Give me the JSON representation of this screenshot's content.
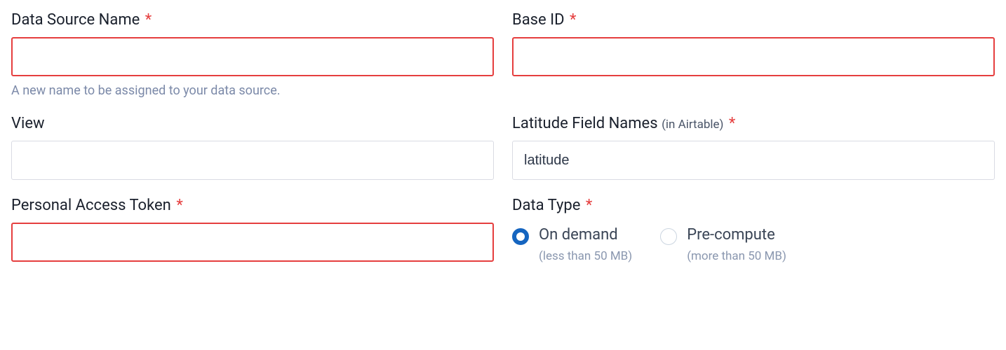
{
  "fields": {
    "data_source_name": {
      "label": "Data Source Name",
      "required_marker": "*",
      "value": "",
      "help": "A new name to be assigned to your data source."
    },
    "base_id": {
      "label": "Base ID",
      "required_marker": "*",
      "value": ""
    },
    "view": {
      "label": "View",
      "value": ""
    },
    "latitude_field_names": {
      "label": "Latitude Field Names",
      "sublabel": "(in Airtable)",
      "required_marker": "*",
      "value": "latitude"
    },
    "personal_access_token": {
      "label": "Personal Access Token",
      "required_marker": "*",
      "value": ""
    },
    "data_type": {
      "label": "Data Type",
      "required_marker": "*",
      "options": [
        {
          "label": "On demand",
          "hint": "(less than 50 MB)",
          "selected": true
        },
        {
          "label": "Pre-compute",
          "hint": "(more than 50 MB)",
          "selected": false
        }
      ]
    }
  }
}
